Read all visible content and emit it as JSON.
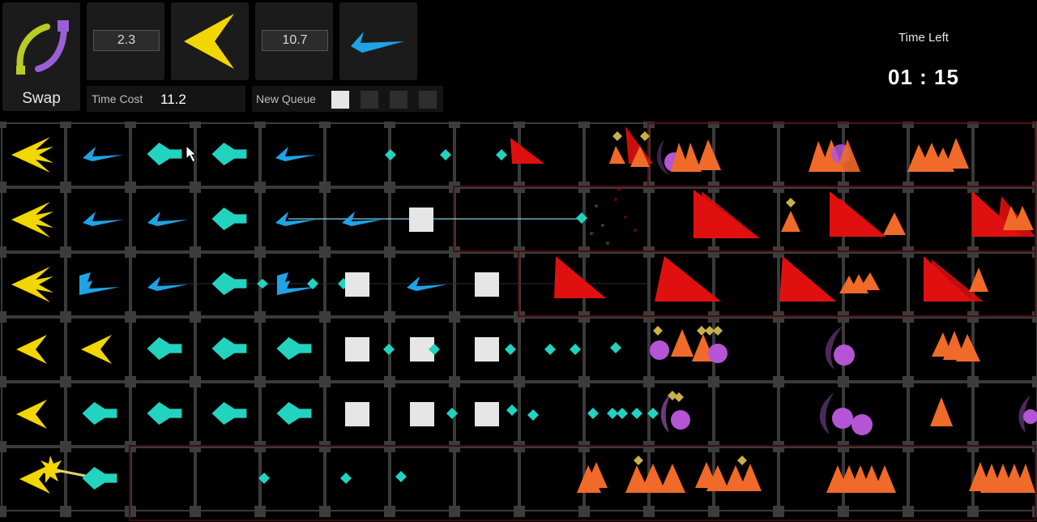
{
  "hud": {
    "swap_label": "Swap",
    "slot1_value": "2.3",
    "slot2_value": "10.7",
    "time_cost_label": "Time Cost",
    "time_cost_value": "11.2",
    "new_queue_label": "New Queue",
    "queue": [
      "filled",
      "empty",
      "empty",
      "empty"
    ],
    "time_left_label": "Time Left",
    "time_left_value": "01 : 15"
  },
  "colors": {
    "yellow_unit": "#f2d600",
    "blue_unit": "#1fa3e6",
    "teal_unit": "#22d3c0",
    "wall": "#e6e6e6",
    "enemy_red": "#e01010",
    "enemy_orange": "#f06a2a",
    "enemy_purple": "#b455d6",
    "gold": "#c9b14a"
  },
  "grid": {
    "rows": 6,
    "cols": 16
  }
}
